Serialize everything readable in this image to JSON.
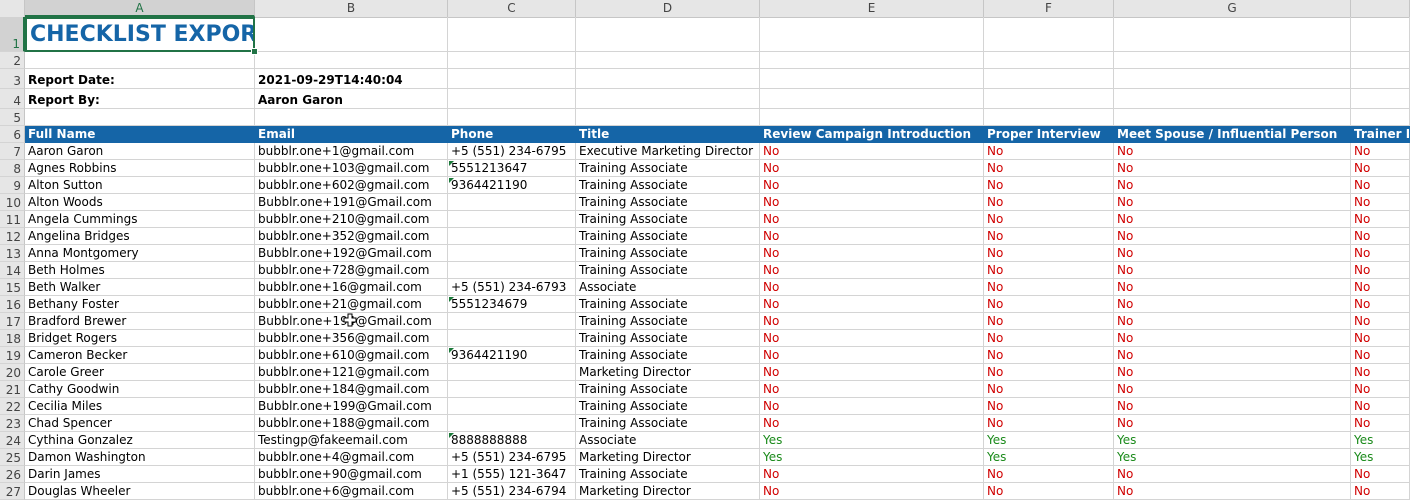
{
  "columns": [
    "A",
    "B",
    "C",
    "D",
    "E",
    "F",
    "G",
    ""
  ],
  "row_numbers": [
    "1",
    "2",
    "3",
    "4",
    "5",
    "6",
    "7",
    "8",
    "9",
    "10",
    "11",
    "12",
    "13",
    "14",
    "15",
    "16",
    "17",
    "18",
    "19",
    "20",
    "21",
    "22",
    "23",
    "24",
    "25",
    "26",
    "27"
  ],
  "title": "CHECKLIST EXPORT",
  "meta": {
    "report_date_label": "Report Date:",
    "report_date_value": "2021-09-29T14:40:04",
    "report_by_label": "Report By:",
    "report_by_value": "Aaron Garon"
  },
  "headers": [
    "Full Name",
    "Email",
    "Phone",
    "Title",
    "Review Campaign Introduction",
    "Proper Interview",
    "Meet Spouse / Influential Person",
    "Trainer M"
  ],
  "status_colors": {
    "no": "#d00000",
    "yes": "#1a8a1a",
    "header_bg": "#1565a7"
  },
  "rows": [
    {
      "name": "Aaron Garon",
      "email": "bubblr.one+1@gmail.com",
      "phone": "+5 (551) 234-6795",
      "title": "Executive Marketing Director",
      "review": "No",
      "interview": "No",
      "spouse": "No",
      "trainer": "No"
    },
    {
      "name": "Agnes Robbins",
      "email": "bubblr.one+103@gmail.com",
      "phone": "5551213647",
      "title": "Training Associate",
      "review": "No",
      "interview": "No",
      "spouse": "No",
      "trainer": "No"
    },
    {
      "name": "Alton Sutton",
      "email": "bubblr.one+602@gmail.com",
      "phone": "9364421190",
      "title": "Training Associate",
      "review": "No",
      "interview": "No",
      "spouse": "No",
      "trainer": "No"
    },
    {
      "name": "Alton Woods",
      "email": "Bubblr.one+191@Gmail.com",
      "phone": "",
      "title": "Training Associate",
      "review": "No",
      "interview": "No",
      "spouse": "No",
      "trainer": "No"
    },
    {
      "name": "Angela Cummings",
      "email": "bubblr.one+210@gmail.com",
      "phone": "",
      "title": "Training Associate",
      "review": "No",
      "interview": "No",
      "spouse": "No",
      "trainer": "No"
    },
    {
      "name": "Angelina Bridges",
      "email": "bubblr.one+352@gmail.com",
      "phone": "",
      "title": "Training Associate",
      "review": "No",
      "interview": "No",
      "spouse": "No",
      "trainer": "No"
    },
    {
      "name": "Anna Montgomery",
      "email": "Bubblr.one+192@Gmail.com",
      "phone": "",
      "title": "Training Associate",
      "review": "No",
      "interview": "No",
      "spouse": "No",
      "trainer": "No"
    },
    {
      "name": "Beth Holmes",
      "email": "bubblr.one+728@gmail.com",
      "phone": "",
      "title": "Training Associate",
      "review": "No",
      "interview": "No",
      "spouse": "No",
      "trainer": "No"
    },
    {
      "name": "Beth Walker",
      "email": "bubblr.one+16@gmail.com",
      "phone": "+5 (551) 234-6793",
      "title": "Associate",
      "review": "No",
      "interview": "No",
      "spouse": "No",
      "trainer": "No"
    },
    {
      "name": "Bethany Foster",
      "email": "bubblr.one+21@gmail.com",
      "phone": "5551234679",
      "title": "Training Associate",
      "review": "No",
      "interview": "No",
      "spouse": "No",
      "trainer": "No"
    },
    {
      "name": "Bradford Brewer",
      "email": "Bubblr.one+194@Gmail.com",
      "phone": "",
      "title": "Training Associate",
      "review": "No",
      "interview": "No",
      "spouse": "No",
      "trainer": "No"
    },
    {
      "name": "Bridget Rogers",
      "email": "bubblr.one+356@gmail.com",
      "phone": "",
      "title": "Training Associate",
      "review": "No",
      "interview": "No",
      "spouse": "No",
      "trainer": "No"
    },
    {
      "name": "Cameron Becker",
      "email": "bubblr.one+610@gmail.com",
      "phone": "9364421190",
      "title": "Training Associate",
      "review": "No",
      "interview": "No",
      "spouse": "No",
      "trainer": "No"
    },
    {
      "name": "Carole Greer",
      "email": "bubblr.one+121@gmail.com",
      "phone": "",
      "title": "Marketing Director",
      "review": "No",
      "interview": "No",
      "spouse": "No",
      "trainer": "No"
    },
    {
      "name": "Cathy Goodwin",
      "email": "bubblr.one+184@gmail.com",
      "phone": "",
      "title": "Training Associate",
      "review": "No",
      "interview": "No",
      "spouse": "No",
      "trainer": "No"
    },
    {
      "name": "Cecilia Miles",
      "email": "Bubblr.one+199@Gmail.com",
      "phone": "",
      "title": "Training Associate",
      "review": "No",
      "interview": "No",
      "spouse": "No",
      "trainer": "No"
    },
    {
      "name": "Chad Spencer",
      "email": "bubblr.one+188@gmail.com",
      "phone": "",
      "title": "Training Associate",
      "review": "No",
      "interview": "No",
      "spouse": "No",
      "trainer": "No"
    },
    {
      "name": "Cythina Gonzalez",
      "email": "Testingp@fakeemail.com",
      "phone": "8888888888",
      "title": "Associate",
      "review": "Yes",
      "interview": "Yes",
      "spouse": "Yes",
      "trainer": "Yes"
    },
    {
      "name": "Damon Washington",
      "email": "bubblr.one+4@gmail.com",
      "phone": "+5 (551) 234-6795",
      "title": "Marketing Director",
      "review": "Yes",
      "interview": "Yes",
      "spouse": "Yes",
      "trainer": "Yes"
    },
    {
      "name": "Darin James",
      "email": "bubblr.one+90@gmail.com",
      "phone": "+1 (555) 121-3647",
      "title": "Training Associate",
      "review": "No",
      "interview": "No",
      "spouse": "No",
      "trainer": "No"
    },
    {
      "name": "Douglas Wheeler",
      "email": "bubblr.one+6@gmail.com",
      "phone": "+5 (551) 234-6794",
      "title": "Marketing Director",
      "review": "No",
      "interview": "No",
      "spouse": "No",
      "trainer": "No"
    }
  ],
  "text_number_flags": [
    false,
    true,
    true,
    false,
    false,
    false,
    false,
    false,
    false,
    true,
    false,
    false,
    true,
    false,
    false,
    false,
    false,
    true,
    false,
    false,
    false
  ]
}
